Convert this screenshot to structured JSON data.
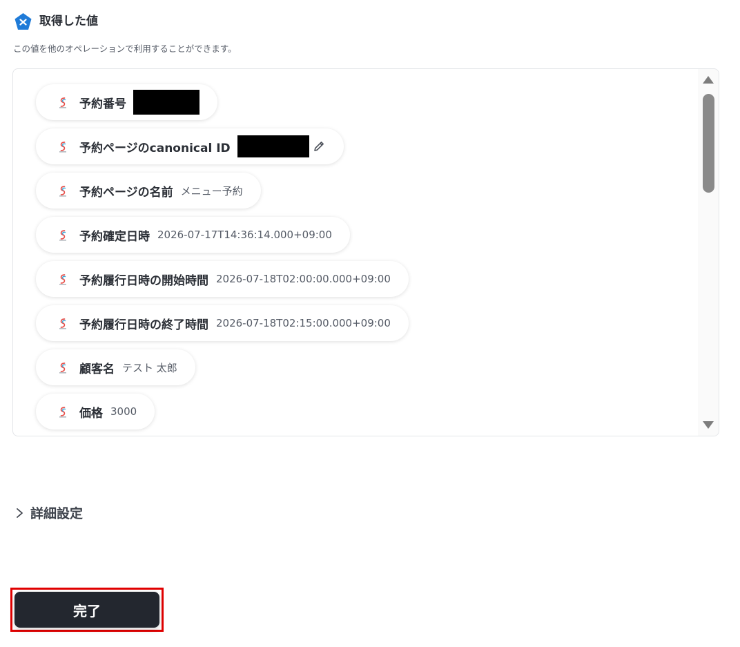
{
  "header": {
    "title": "取得した値",
    "subtitle": "この値を他のオペレーションで利用することができます。",
    "icon": "app-logo-icon"
  },
  "fields": [
    {
      "label": "予約番号",
      "value": "",
      "redacted": true
    },
    {
      "label": "予約ページのcanonical ID",
      "value": "",
      "redacted": true,
      "editable": true
    },
    {
      "label": "予約ページの名前",
      "value": "メニュー予約"
    },
    {
      "label": "予約確定日時",
      "value": "2026-07-17T14:36:14.000+09:00"
    },
    {
      "label": "予約履行日時の開始時間",
      "value": "2026-07-18T02:00:00.000+09:00"
    },
    {
      "label": "予約履行日時の終了時間",
      "value": "2026-07-18T02:15:00.000+09:00"
    },
    {
      "label": "顧客名",
      "value": "テスト 太郎"
    },
    {
      "label": "価格",
      "value": "3000"
    }
  ],
  "advanced": {
    "label": "詳細設定"
  },
  "done_button": {
    "label": "完了"
  },
  "colors": {
    "accent": "#1f7bd8",
    "button_bg": "#23272f",
    "highlight": "#e00000"
  }
}
